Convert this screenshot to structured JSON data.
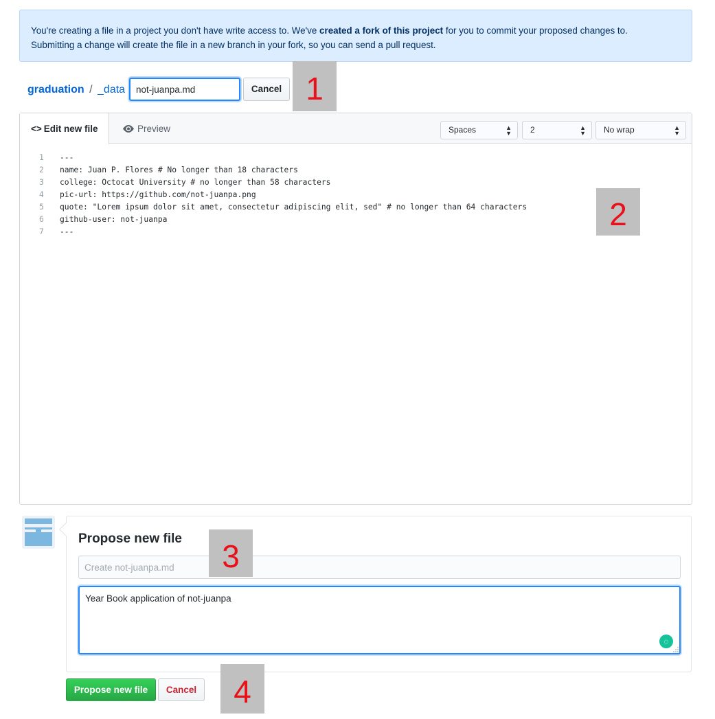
{
  "notice": {
    "part1": "You're creating a file in a project you don't have write access to. We've ",
    "bold": "created a fork of this project",
    "part2": " for you to commit your proposed changes to.",
    "line2": "Submitting a change will create the file in a new branch in your fork, so you can send a pull request."
  },
  "breadcrumb": {
    "repo": "graduation",
    "dir": "_data",
    "sep": "/"
  },
  "filename": {
    "value": "not-juanpa.md"
  },
  "header_cancel_label": "Cancel",
  "editor": {
    "tab_edit_label": "Edit new file",
    "tab_preview_label": "Preview",
    "indent_mode": "Spaces",
    "indent_size": "2",
    "wrap_mode": "No wrap",
    "lines": [
      {
        "n": "1",
        "text": "---"
      },
      {
        "n": "2",
        "text": "name: Juan P. Flores # No longer than 18 characters"
      },
      {
        "n": "3",
        "text": "college: Octocat University # no longer than 58 characters"
      },
      {
        "n": "4",
        "text": "pic-url: https://github.com/not-juanpa.png"
      },
      {
        "n": "5",
        "text": "quote: \"Lorem ipsum dolor sit amet, consectetur adipiscing elit, sed\" # no longer than 64 characters"
      },
      {
        "n": "6",
        "text": "github-user: not-juanpa"
      },
      {
        "n": "7",
        "text": "---"
      }
    ]
  },
  "commit": {
    "title": "Propose new file",
    "summary_placeholder": "Create not-juanpa.md",
    "description": "Year Book application of not-juanpa",
    "submit_label": "Propose new file",
    "cancel_label": "Cancel"
  },
  "markers": [
    "1",
    "2",
    "3",
    "4"
  ],
  "colors": {
    "accent": "#0366d6",
    "primary": "#28a745",
    "danger": "#cb2431",
    "marker_text": "#e8111b"
  },
  "icons": [
    "code-icon",
    "eye-icon",
    "select-arrows-icon",
    "avatar-icon",
    "grammarly-icon",
    "resize-handle-icon"
  ]
}
